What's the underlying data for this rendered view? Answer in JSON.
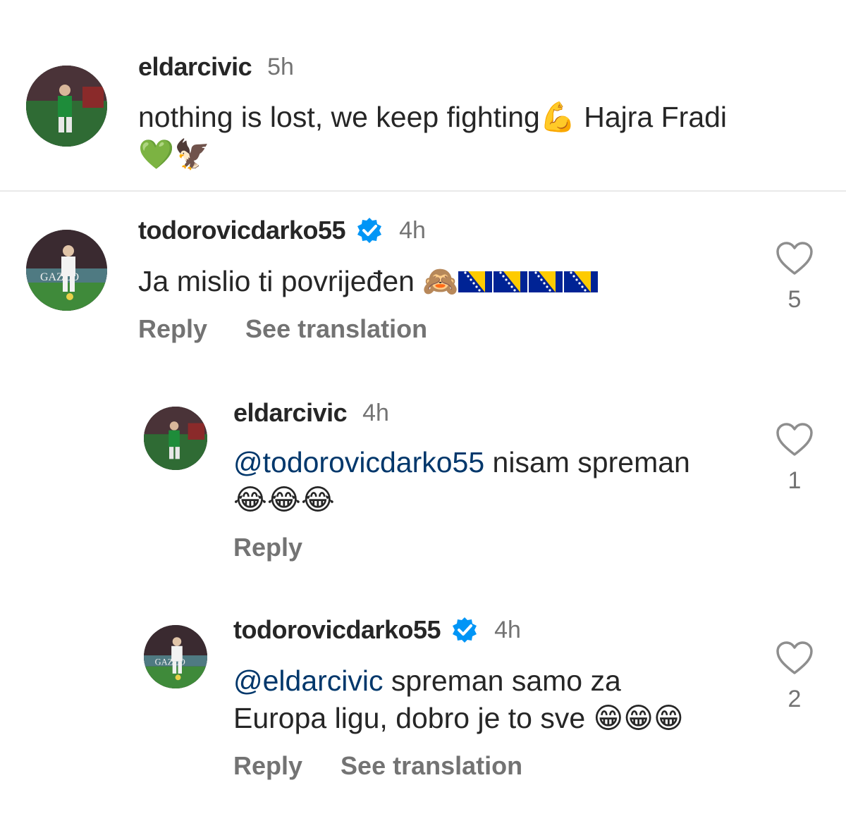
{
  "comments": [
    {
      "username": "eldarcivic",
      "time": "5h",
      "text_line1": "nothing is lost, we keep fighting",
      "emoji_flex": "💪",
      "text_after_emoji": " Hajra Fradi",
      "text_line2_emojis": "💚🦅"
    },
    {
      "username": "todorovicdarko55",
      "verified": true,
      "time": "4h",
      "text": "Ja mislio ti povrijeđen ",
      "emoji_monkey": "🙈",
      "flags_count": 4,
      "reply_label": "Reply",
      "translate_label": "See translation",
      "likes": "5"
    },
    {
      "username": "eldarcivic",
      "time": "4h",
      "mention": "@todorovicdarko55",
      "text": " nisam spreman",
      "text_line2_emojis": "😂😂😂",
      "reply_label": "Reply",
      "likes": "1"
    },
    {
      "username": "todorovicdarko55",
      "verified": true,
      "time": "4h",
      "mention": "@eldarcivic",
      "text": " spreman samo za",
      "text_line2": "Europa ligu, dobro je to sve ",
      "text_line2_emojis": "😁😁😁",
      "reply_label": "Reply",
      "translate_label": "See translation",
      "likes": "2"
    }
  ],
  "icons": {
    "verified": "verified-badge-icon",
    "like": "heart-outline-icon"
  },
  "colors": {
    "verified_blue": "#0095f6",
    "mention": "#00376b",
    "secondary_text": "#737373"
  }
}
